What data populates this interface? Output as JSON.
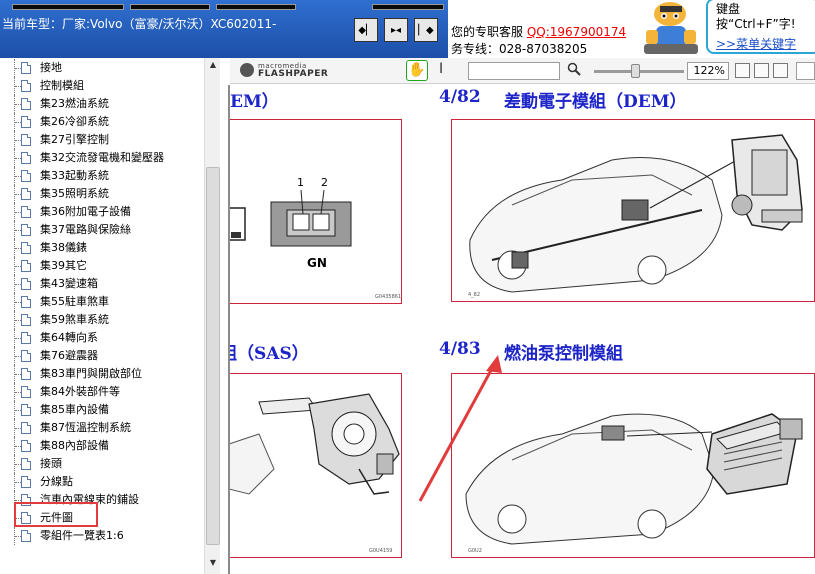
{
  "header": {
    "car_model": "当前车型：厂家:Volvo（富豪/沃尔沃）XC602011-",
    "nav_icons": [
      "first-page-icon",
      "split-view-icon",
      "next-page-icon"
    ]
  },
  "service": {
    "line1_prefix": "您的专职客服",
    "qq": "QQ:1967900174",
    "line2": "务专线：028-87038205"
  },
  "tip": {
    "text": "键盘按“Ctrl+F”字!",
    "link": ">>菜单关键字"
  },
  "sidebar": {
    "items": [
      {
        "label": "接地"
      },
      {
        "label": "控制模組"
      },
      {
        "label": "集23燃油系統"
      },
      {
        "label": "集26冷卻系統"
      },
      {
        "label": "集27引擎控制"
      },
      {
        "label": "集32交流發電機和變壓器"
      },
      {
        "label": "集33起動系統"
      },
      {
        "label": "集35照明系統"
      },
      {
        "label": "集36附加電子設備"
      },
      {
        "label": "集37電路與保險絲"
      },
      {
        "label": "集38儀錶"
      },
      {
        "label": "集39其它"
      },
      {
        "label": "集43變速箱"
      },
      {
        "label": "集55駐車煞車"
      },
      {
        "label": "集59煞車系統"
      },
      {
        "label": "集64轉向系"
      },
      {
        "label": "集76避震器"
      },
      {
        "label": "集83車門與開啟部位"
      },
      {
        "label": "集84外裝部件等"
      },
      {
        "label": "集85車內設備"
      },
      {
        "label": "集87恆溫控制系統"
      },
      {
        "label": "集88內部設備"
      },
      {
        "label": "接頭"
      },
      {
        "label": "分線點"
      },
      {
        "label": "汽車內電線束的鋪設"
      },
      {
        "label": "元件圖"
      },
      {
        "label": "零組件一覽表1:6"
      }
    ],
    "selected": "元件圖"
  },
  "flashpaper": {
    "brand_small": "macromedia",
    "brand": "FLASHPAPER",
    "zoom": "122%",
    "search_value": ""
  },
  "document": {
    "top_left_title": "EM）",
    "top_right_num": "4/82",
    "top_right_title": "差動電子模組（DEM）",
    "bottom_left_title": "組（SAS）",
    "bottom_right_num": "4/83",
    "bottom_right_title": "燃油泵控制模組",
    "connector_label_1": "1",
    "connector_label_2": "2",
    "connector_color": "GN",
    "fig_id_1": "G0435861",
    "fig_id_2": "4_82",
    "fig_id_3": "G0U4159",
    "fig_id_4": "G0U2"
  },
  "colors": {
    "header_blue": "#2563c4",
    "title_blue": "#1d24c8",
    "frame_red": "#d0243d",
    "annotation_red": "#e23b3b"
  }
}
